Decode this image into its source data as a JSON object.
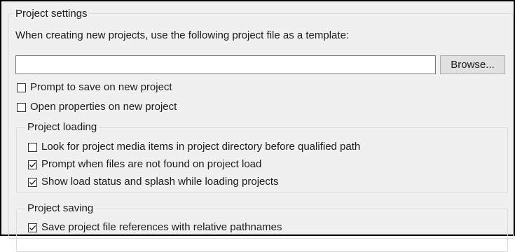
{
  "project_settings": {
    "title": "Project settings",
    "template_instruction": "When creating new projects, use the following project file as a template:",
    "template_path": {
      "value": "",
      "placeholder": ""
    },
    "browse_label": "Browse...",
    "prompt_save": {
      "label": "Prompt to save on new project",
      "checked": false
    },
    "open_properties": {
      "label": "Open properties on new project",
      "checked": false
    }
  },
  "project_loading": {
    "title": "Project loading",
    "look_for_media": {
      "label": "Look for project media items in project directory before qualified path",
      "checked": false
    },
    "prompt_files_missing": {
      "label": "Prompt when files are not found on project load",
      "checked": true
    },
    "show_load_status": {
      "label": "Show load status and splash while loading projects",
      "checked": true
    }
  },
  "project_saving": {
    "title": "Project saving",
    "relative_paths": {
      "label": "Save project file references with relative pathnames",
      "checked": true
    }
  }
}
